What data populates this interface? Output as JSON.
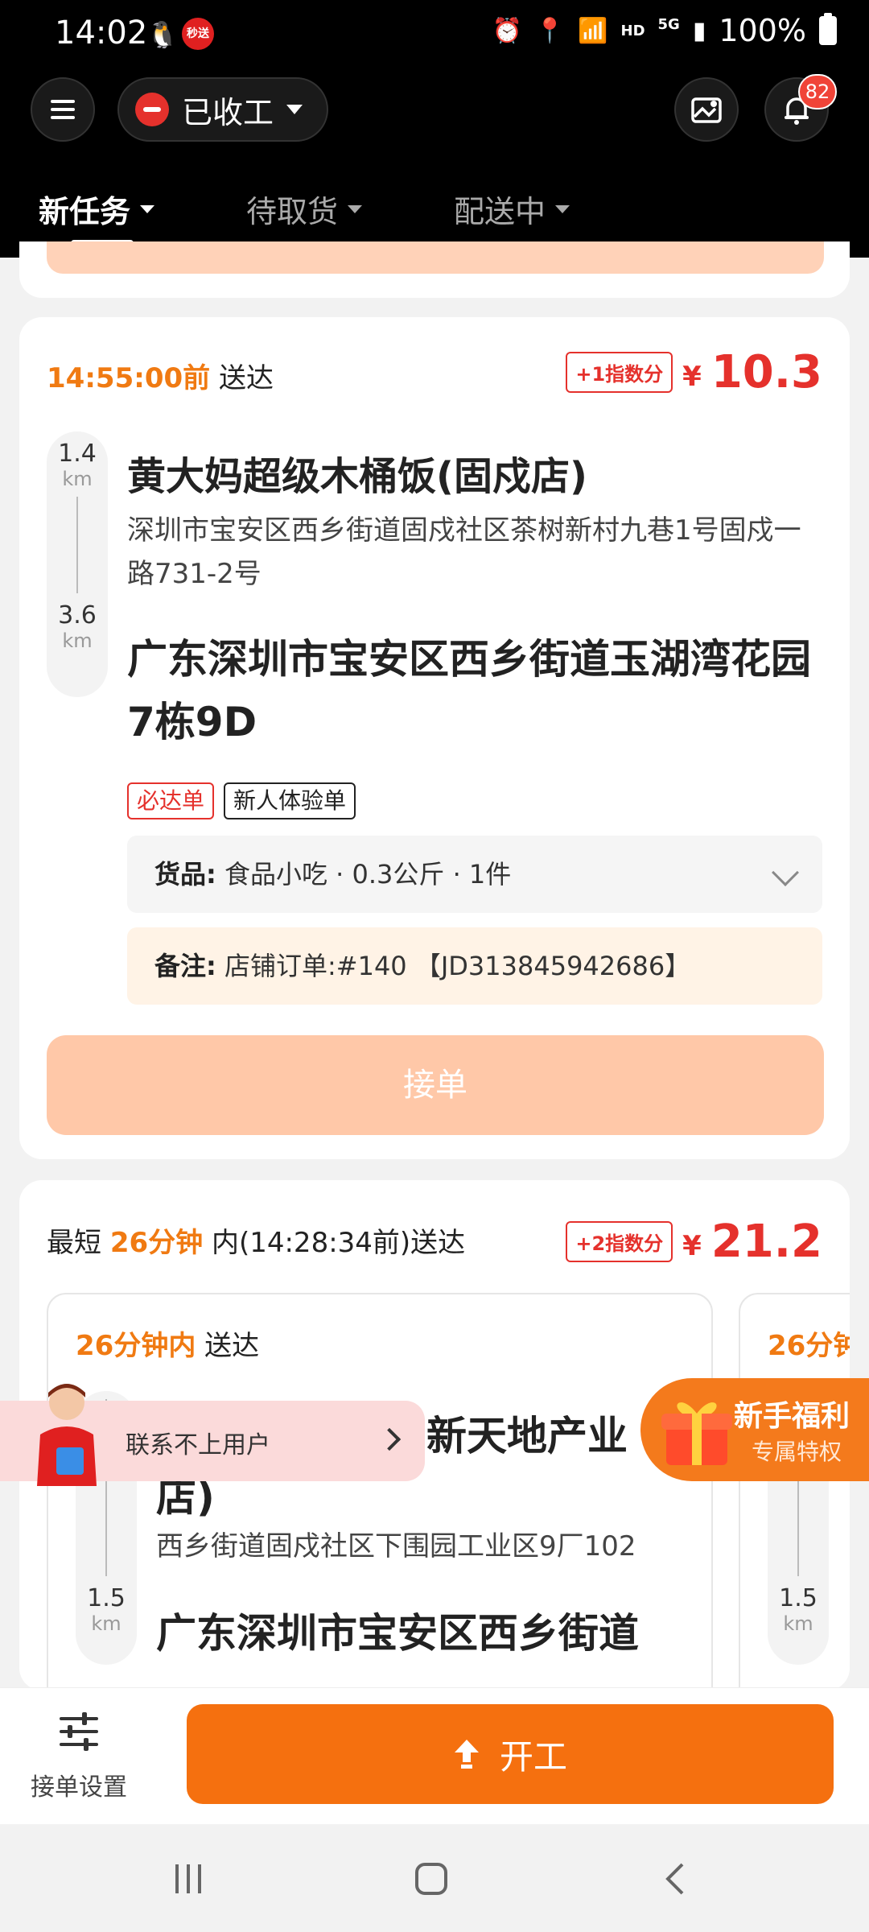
{
  "status_bar": {
    "time": "14:02",
    "app_badge": "秒送",
    "hd": "HD",
    "network": "5G",
    "battery": "100%"
  },
  "header": {
    "work_status": "已收工",
    "notification_count": "82",
    "tabs": [
      {
        "label": "新任务",
        "active": true
      },
      {
        "label": "待取货",
        "active": false
      },
      {
        "label": "配送中",
        "active": false
      }
    ]
  },
  "order1": {
    "deliver_time": "14:55:00前",
    "deliver_suffix": "送达",
    "index_badge": "+1指数分",
    "currency": "¥",
    "price": "10.3",
    "pickup_distance": "1.4",
    "dropoff_distance": "3.6",
    "unit": "km",
    "shop_name": "黄大妈超级木桶饭(固戍店)",
    "shop_address": "深圳市宝安区西乡街道固戍社区茶树新村九巷1号固戍一路731-2号",
    "destination": "广东深圳市宝安区西乡街道玉湖湾花园7栋9D",
    "tags": [
      "必达单",
      "新人体验单"
    ],
    "goods_label": "货品:",
    "goods_value": "食品小吃 · 0.3公斤 · 1件",
    "remark_label": "备注:",
    "remark_value": "店铺订单:#140 【JD313845942686】",
    "accept_button": "接单"
  },
  "order2": {
    "prefix": "最短",
    "duration": "26分钟",
    "suffix": "内(14:28:34前)送达",
    "index_badge": "+2指数分",
    "currency": "¥",
    "price": "21.2",
    "sub_orders": [
      {
        "duration": "26分钟内",
        "deliver_suffix": "送达",
        "shop_name_visible": "新天地产业",
        "shop_name_line2": "店)",
        "shop_address": "西乡街道固戍社区下围园工业区9厂102",
        "distance": "1.5",
        "unit": "km",
        "destination_visible": "广东深圳市宝安区西乡街道"
      },
      {
        "duration": "26分钟",
        "distance": "1.5",
        "unit": "km"
      }
    ]
  },
  "floating": {
    "contact_text": "联系不上用户",
    "welfare_title": "新手福利",
    "welfare_subtitle": "专属特权"
  },
  "bottom_bar": {
    "settings_label": "接单设置",
    "start_button": "开工"
  },
  "colors": {
    "accent_orange": "#f5700f",
    "price_red": "#e5312c",
    "header_black": "#000000"
  }
}
